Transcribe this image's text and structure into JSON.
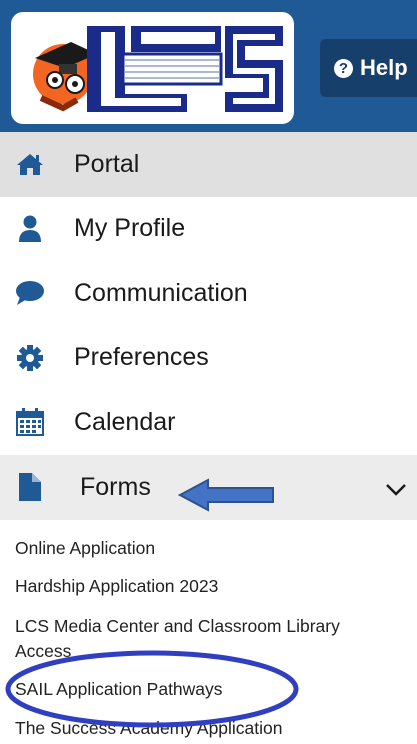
{
  "header": {
    "logo_text": "LCS",
    "help_label": "Help",
    "help_icon": "question-circle-icon"
  },
  "nav": {
    "items": [
      {
        "label": "Portal",
        "icon": "home-icon"
      },
      {
        "label": "My Profile",
        "icon": "user-icon"
      },
      {
        "label": "Communication",
        "icon": "chat-icon"
      },
      {
        "label": "Preferences",
        "icon": "gear-icon"
      },
      {
        "label": "Calendar",
        "icon": "calendar-icon"
      },
      {
        "label": "Forms",
        "icon": "file-icon"
      }
    ]
  },
  "forms": {
    "subitems": [
      "Online Application",
      "Hardship Application 2023",
      "LCS Media Center and Classroom Library",
      "Access",
      "SAIL Application Pathways",
      "The Success Academy Application"
    ]
  },
  "colors": {
    "header_blue": "#1f5a96",
    "icon_blue": "#1f5a96",
    "annotation_blue": "#2f3fbf",
    "arrow_fill": "#4472c4"
  }
}
